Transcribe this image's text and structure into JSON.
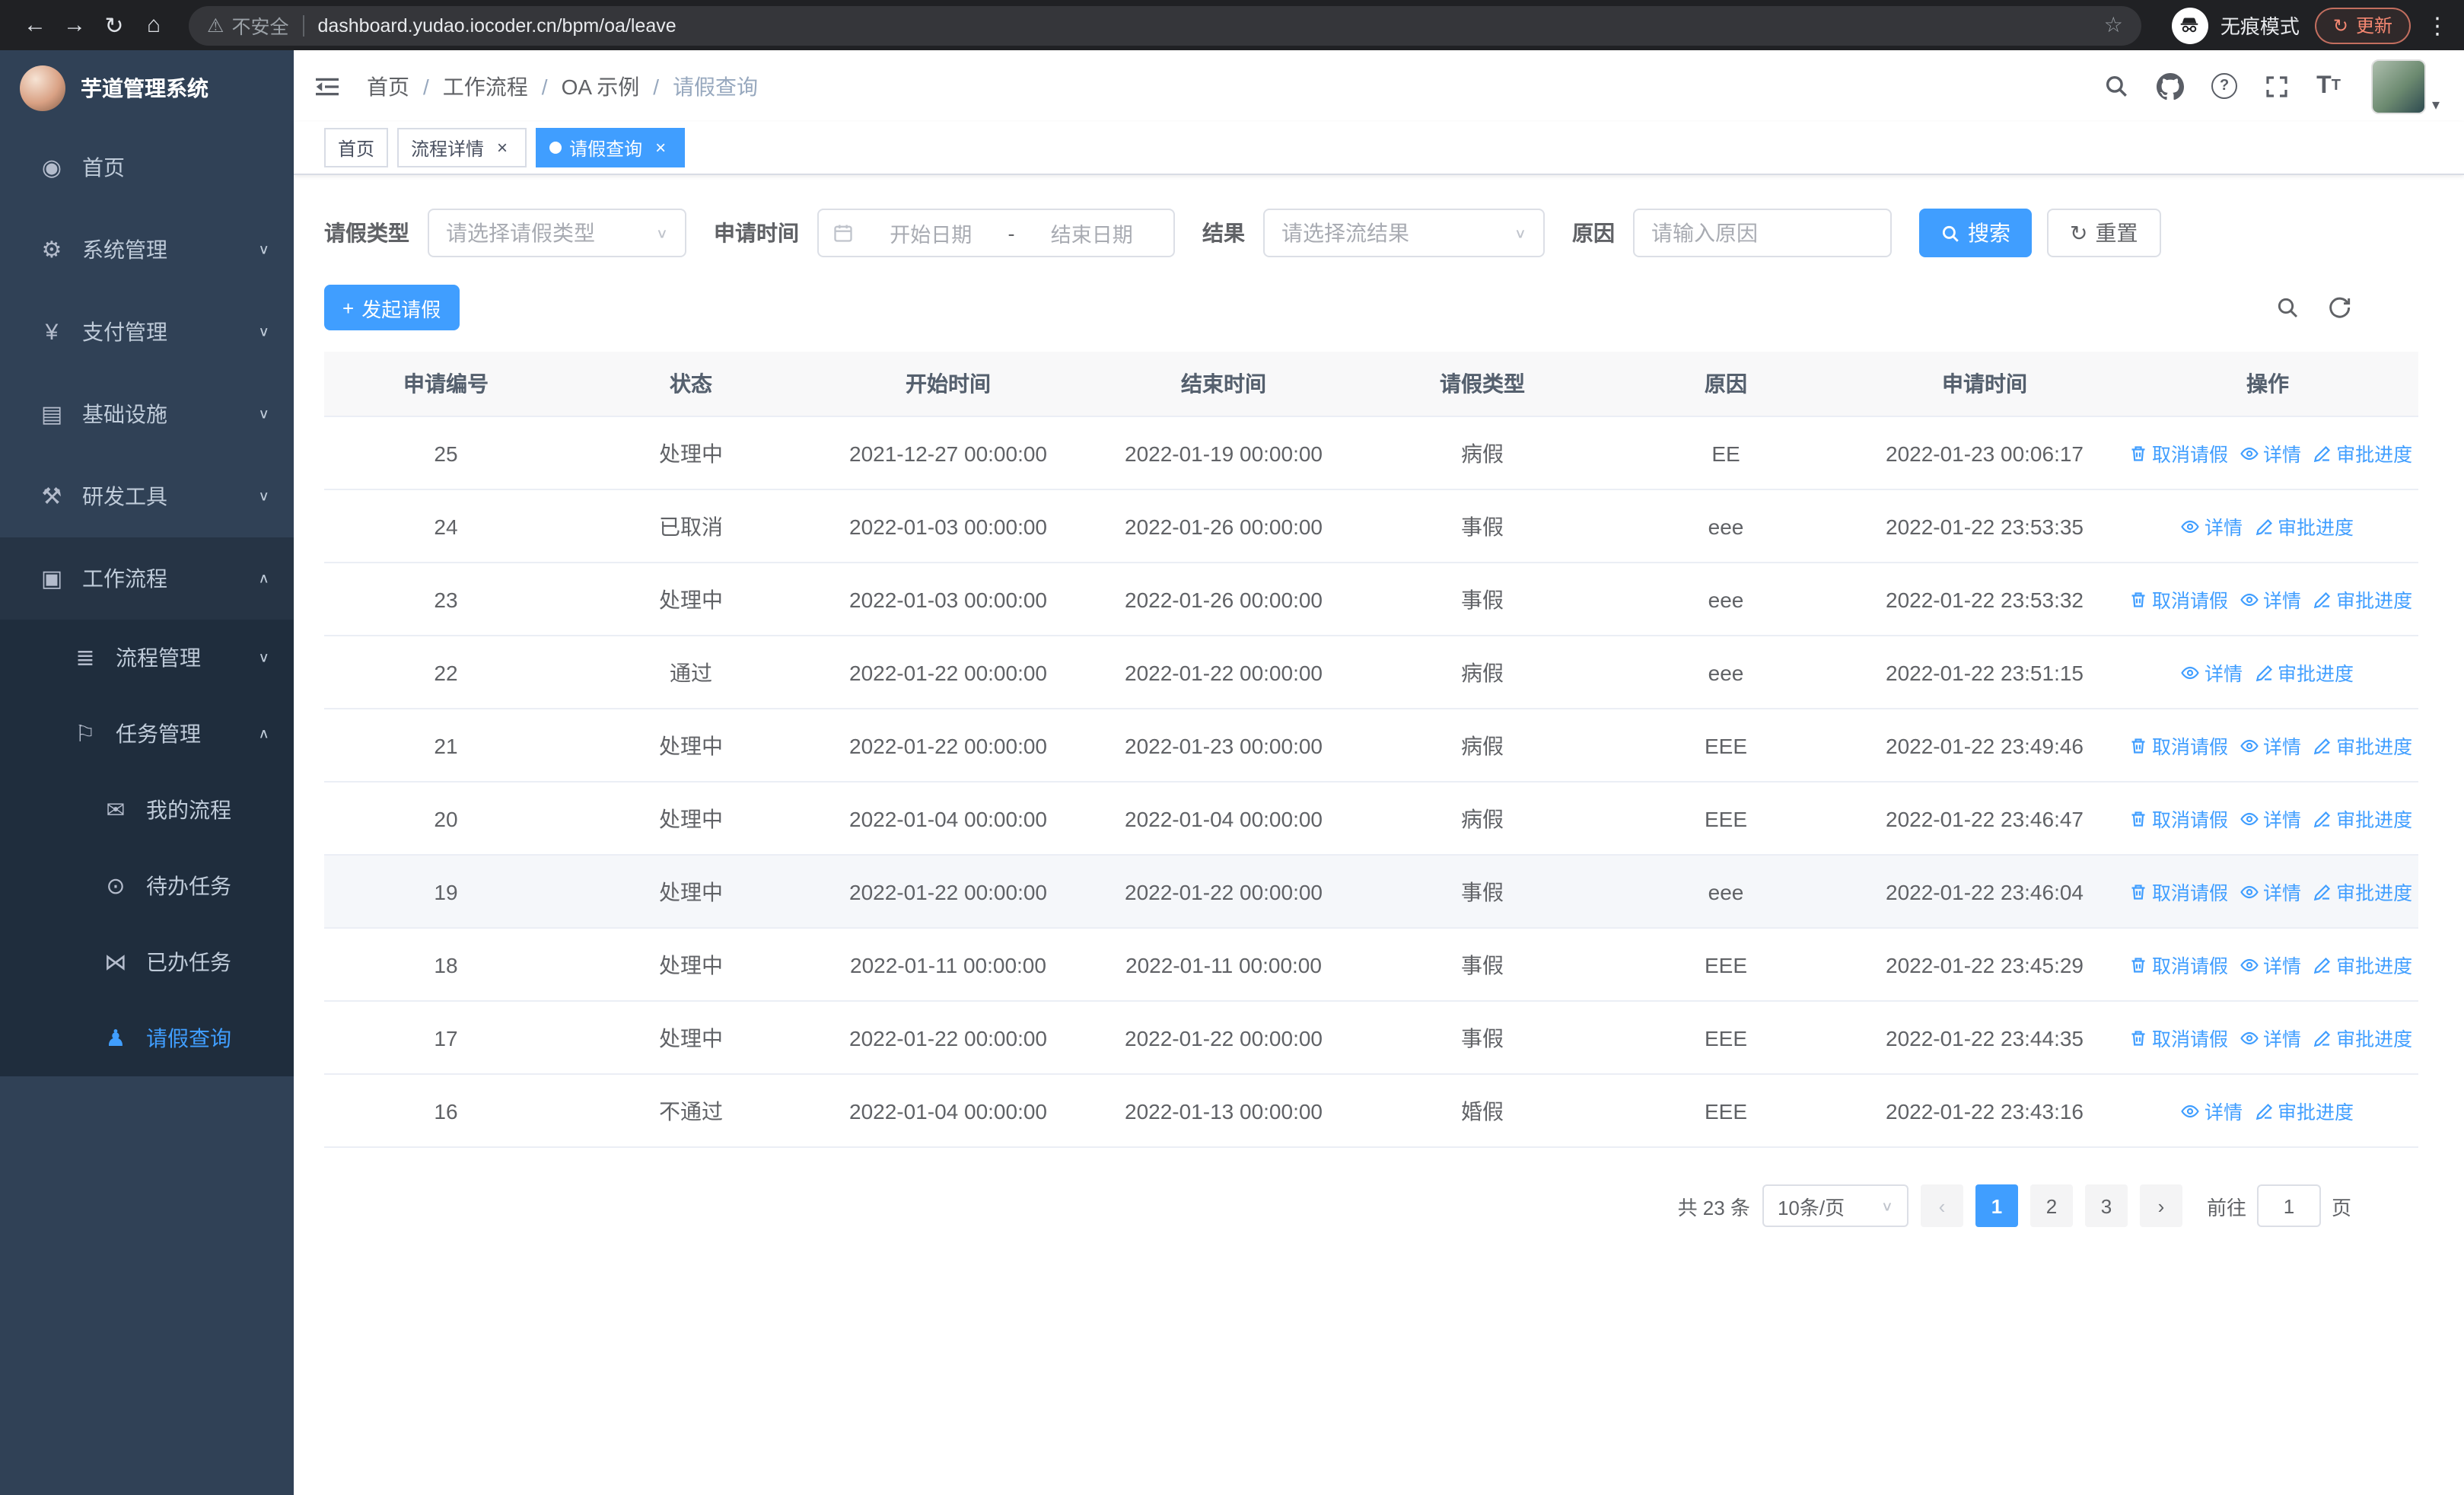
{
  "browser": {
    "security_warning": "不安全",
    "url": "dashboard.yudao.iocoder.cn/bpm/oa/leave",
    "incognito_label": "无痕模式",
    "update_button": "更新"
  },
  "icons": {
    "back": "←",
    "forward": "→",
    "reload": "↻",
    "home": "⌂",
    "warning": "⚠",
    "star": "☆",
    "menu_dots": "⋮",
    "dashboard": "◉",
    "gear": "⚙",
    "yen": "¥",
    "infra": "▤",
    "tools": "⚒",
    "workflow": "▣",
    "process": "≣",
    "task": "⚐",
    "chat": "✉",
    "eye": "⊙",
    "done": "⋈",
    "user": "♟",
    "chevron_down": "∨",
    "chevron_up": "∧",
    "select_arrow": "∨",
    "prev": "‹",
    "next": "›",
    "reset": "↻",
    "caret": "▾",
    "plus": "+",
    "dash": "-"
  },
  "sidebar": {
    "app_title": "芋道管理系统",
    "items": [
      {
        "key": "home",
        "label": "首页",
        "icon": "dashboard",
        "level": 1
      },
      {
        "key": "system",
        "label": "系统管理",
        "icon": "gear",
        "level": 1,
        "chevron": "down"
      },
      {
        "key": "payment",
        "label": "支付管理",
        "icon": "yen",
        "level": 1,
        "chevron": "down"
      },
      {
        "key": "infrastructure",
        "label": "基础设施",
        "icon": "infra",
        "level": 1,
        "chevron": "down"
      },
      {
        "key": "dev-tools",
        "label": "研发工具",
        "icon": "tools",
        "level": 1,
        "chevron": "down"
      },
      {
        "key": "workflow",
        "label": "工作流程",
        "icon": "workflow",
        "level": 1,
        "chevron": "up",
        "open": true
      },
      {
        "key": "process-mgmt",
        "label": "流程管理",
        "icon": "process",
        "level": 2,
        "chevron": "down"
      },
      {
        "key": "task-mgmt",
        "label": "任务管理",
        "icon": "task",
        "level": 2,
        "chevron": "up"
      },
      {
        "key": "my-process",
        "label": "我的流程",
        "icon": "chat",
        "level": 3
      },
      {
        "key": "todo-tasks",
        "label": "待办任务",
        "icon": "eye",
        "level": 3
      },
      {
        "key": "done-tasks",
        "label": "已办任务",
        "icon": "done",
        "level": 3
      },
      {
        "key": "leave-query",
        "label": "请假查询",
        "icon": "user",
        "level": 3,
        "active": true
      }
    ]
  },
  "header": {
    "breadcrumb": [
      "首页",
      "工作流程",
      "OA 示例",
      "请假查询"
    ]
  },
  "tabs": [
    {
      "key": "home",
      "label": "首页",
      "closable": false,
      "active": false
    },
    {
      "key": "process-detail",
      "label": "流程详情",
      "closable": true,
      "active": false
    },
    {
      "key": "leave-query",
      "label": "请假查询",
      "closable": true,
      "active": true
    }
  ],
  "filters": {
    "leave_type_label": "请假类型",
    "leave_type_placeholder": "请选择请假类型",
    "apply_time_label": "申请时间",
    "start_date_placeholder": "开始日期",
    "end_date_placeholder": "结束日期",
    "result_label": "结果",
    "result_placeholder": "请选择流结果",
    "reason_label": "原因",
    "reason_placeholder": "请输入原因",
    "search_button": "搜索",
    "reset_button": "重置"
  },
  "toolbar": {
    "create_button": "发起请假"
  },
  "table": {
    "columns": [
      "申请编号",
      "状态",
      "开始时间",
      "结束时间",
      "请假类型",
      "原因",
      "申请时间",
      "操作"
    ],
    "action_defs": {
      "cancel": {
        "label": "取消请假",
        "icon": "trash"
      },
      "detail": {
        "label": "详情",
        "icon": "eye"
      },
      "progress": {
        "label": "审批进度",
        "icon": "edit"
      }
    },
    "rows": [
      {
        "id": "25",
        "status": "处理中",
        "start_time": "2021-12-27 00:00:00",
        "end_time": "2022-01-19 00:00:00",
        "leave_type": "病假",
        "reason": "EE",
        "apply_time": "2022-01-23 00:06:17",
        "actions": [
          "cancel",
          "detail",
          "progress"
        ]
      },
      {
        "id": "24",
        "status": "已取消",
        "start_time": "2022-01-03 00:00:00",
        "end_time": "2022-01-26 00:00:00",
        "leave_type": "事假",
        "reason": "eee",
        "apply_time": "2022-01-22 23:53:35",
        "actions": [
          "detail",
          "progress"
        ]
      },
      {
        "id": "23",
        "status": "处理中",
        "start_time": "2022-01-03 00:00:00",
        "end_time": "2022-01-26 00:00:00",
        "leave_type": "事假",
        "reason": "eee",
        "apply_time": "2022-01-22 23:53:32",
        "actions": [
          "cancel",
          "detail",
          "progress"
        ]
      },
      {
        "id": "22",
        "status": "通过",
        "start_time": "2022-01-22 00:00:00",
        "end_time": "2022-01-22 00:00:00",
        "leave_type": "病假",
        "reason": "eee",
        "apply_time": "2022-01-22 23:51:15",
        "actions": [
          "detail",
          "progress"
        ]
      },
      {
        "id": "21",
        "status": "处理中",
        "start_time": "2022-01-22 00:00:00",
        "end_time": "2022-01-23 00:00:00",
        "leave_type": "病假",
        "reason": "EEE",
        "apply_time": "2022-01-22 23:49:46",
        "actions": [
          "cancel",
          "detail",
          "progress"
        ]
      },
      {
        "id": "20",
        "status": "处理中",
        "start_time": "2022-01-04 00:00:00",
        "end_time": "2022-01-04 00:00:00",
        "leave_type": "病假",
        "reason": "EEE",
        "apply_time": "2022-01-22 23:46:47",
        "actions": [
          "cancel",
          "detail",
          "progress"
        ]
      },
      {
        "id": "19",
        "status": "处理中",
        "start_time": "2022-01-22 00:00:00",
        "end_time": "2022-01-22 00:00:00",
        "leave_type": "事假",
        "reason": "eee",
        "apply_time": "2022-01-22 23:46:04",
        "actions": [
          "cancel",
          "detail",
          "progress"
        ],
        "highlighted": true
      },
      {
        "id": "18",
        "status": "处理中",
        "start_time": "2022-01-11 00:00:00",
        "end_time": "2022-01-11 00:00:00",
        "leave_type": "事假",
        "reason": "EEE",
        "apply_time": "2022-01-22 23:45:29",
        "actions": [
          "cancel",
          "detail",
          "progress"
        ]
      },
      {
        "id": "17",
        "status": "处理中",
        "start_time": "2022-01-22 00:00:00",
        "end_time": "2022-01-22 00:00:00",
        "leave_type": "事假",
        "reason": "EEE",
        "apply_time": "2022-01-22 23:44:35",
        "actions": [
          "cancel",
          "detail",
          "progress"
        ]
      },
      {
        "id": "16",
        "status": "不通过",
        "start_time": "2022-01-04 00:00:00",
        "end_time": "2022-01-13 00:00:00",
        "leave_type": "婚假",
        "reason": "EEE",
        "apply_time": "2022-01-22 23:43:16",
        "actions": [
          "detail",
          "progress"
        ]
      }
    ]
  },
  "pagination": {
    "total_text": "共 23 条",
    "page_size_label": "10条/页",
    "pages": [
      "1",
      "2",
      "3"
    ],
    "current_page": "1",
    "goto_label": "前往",
    "goto_value": "1",
    "goto_unit": "页"
  }
}
